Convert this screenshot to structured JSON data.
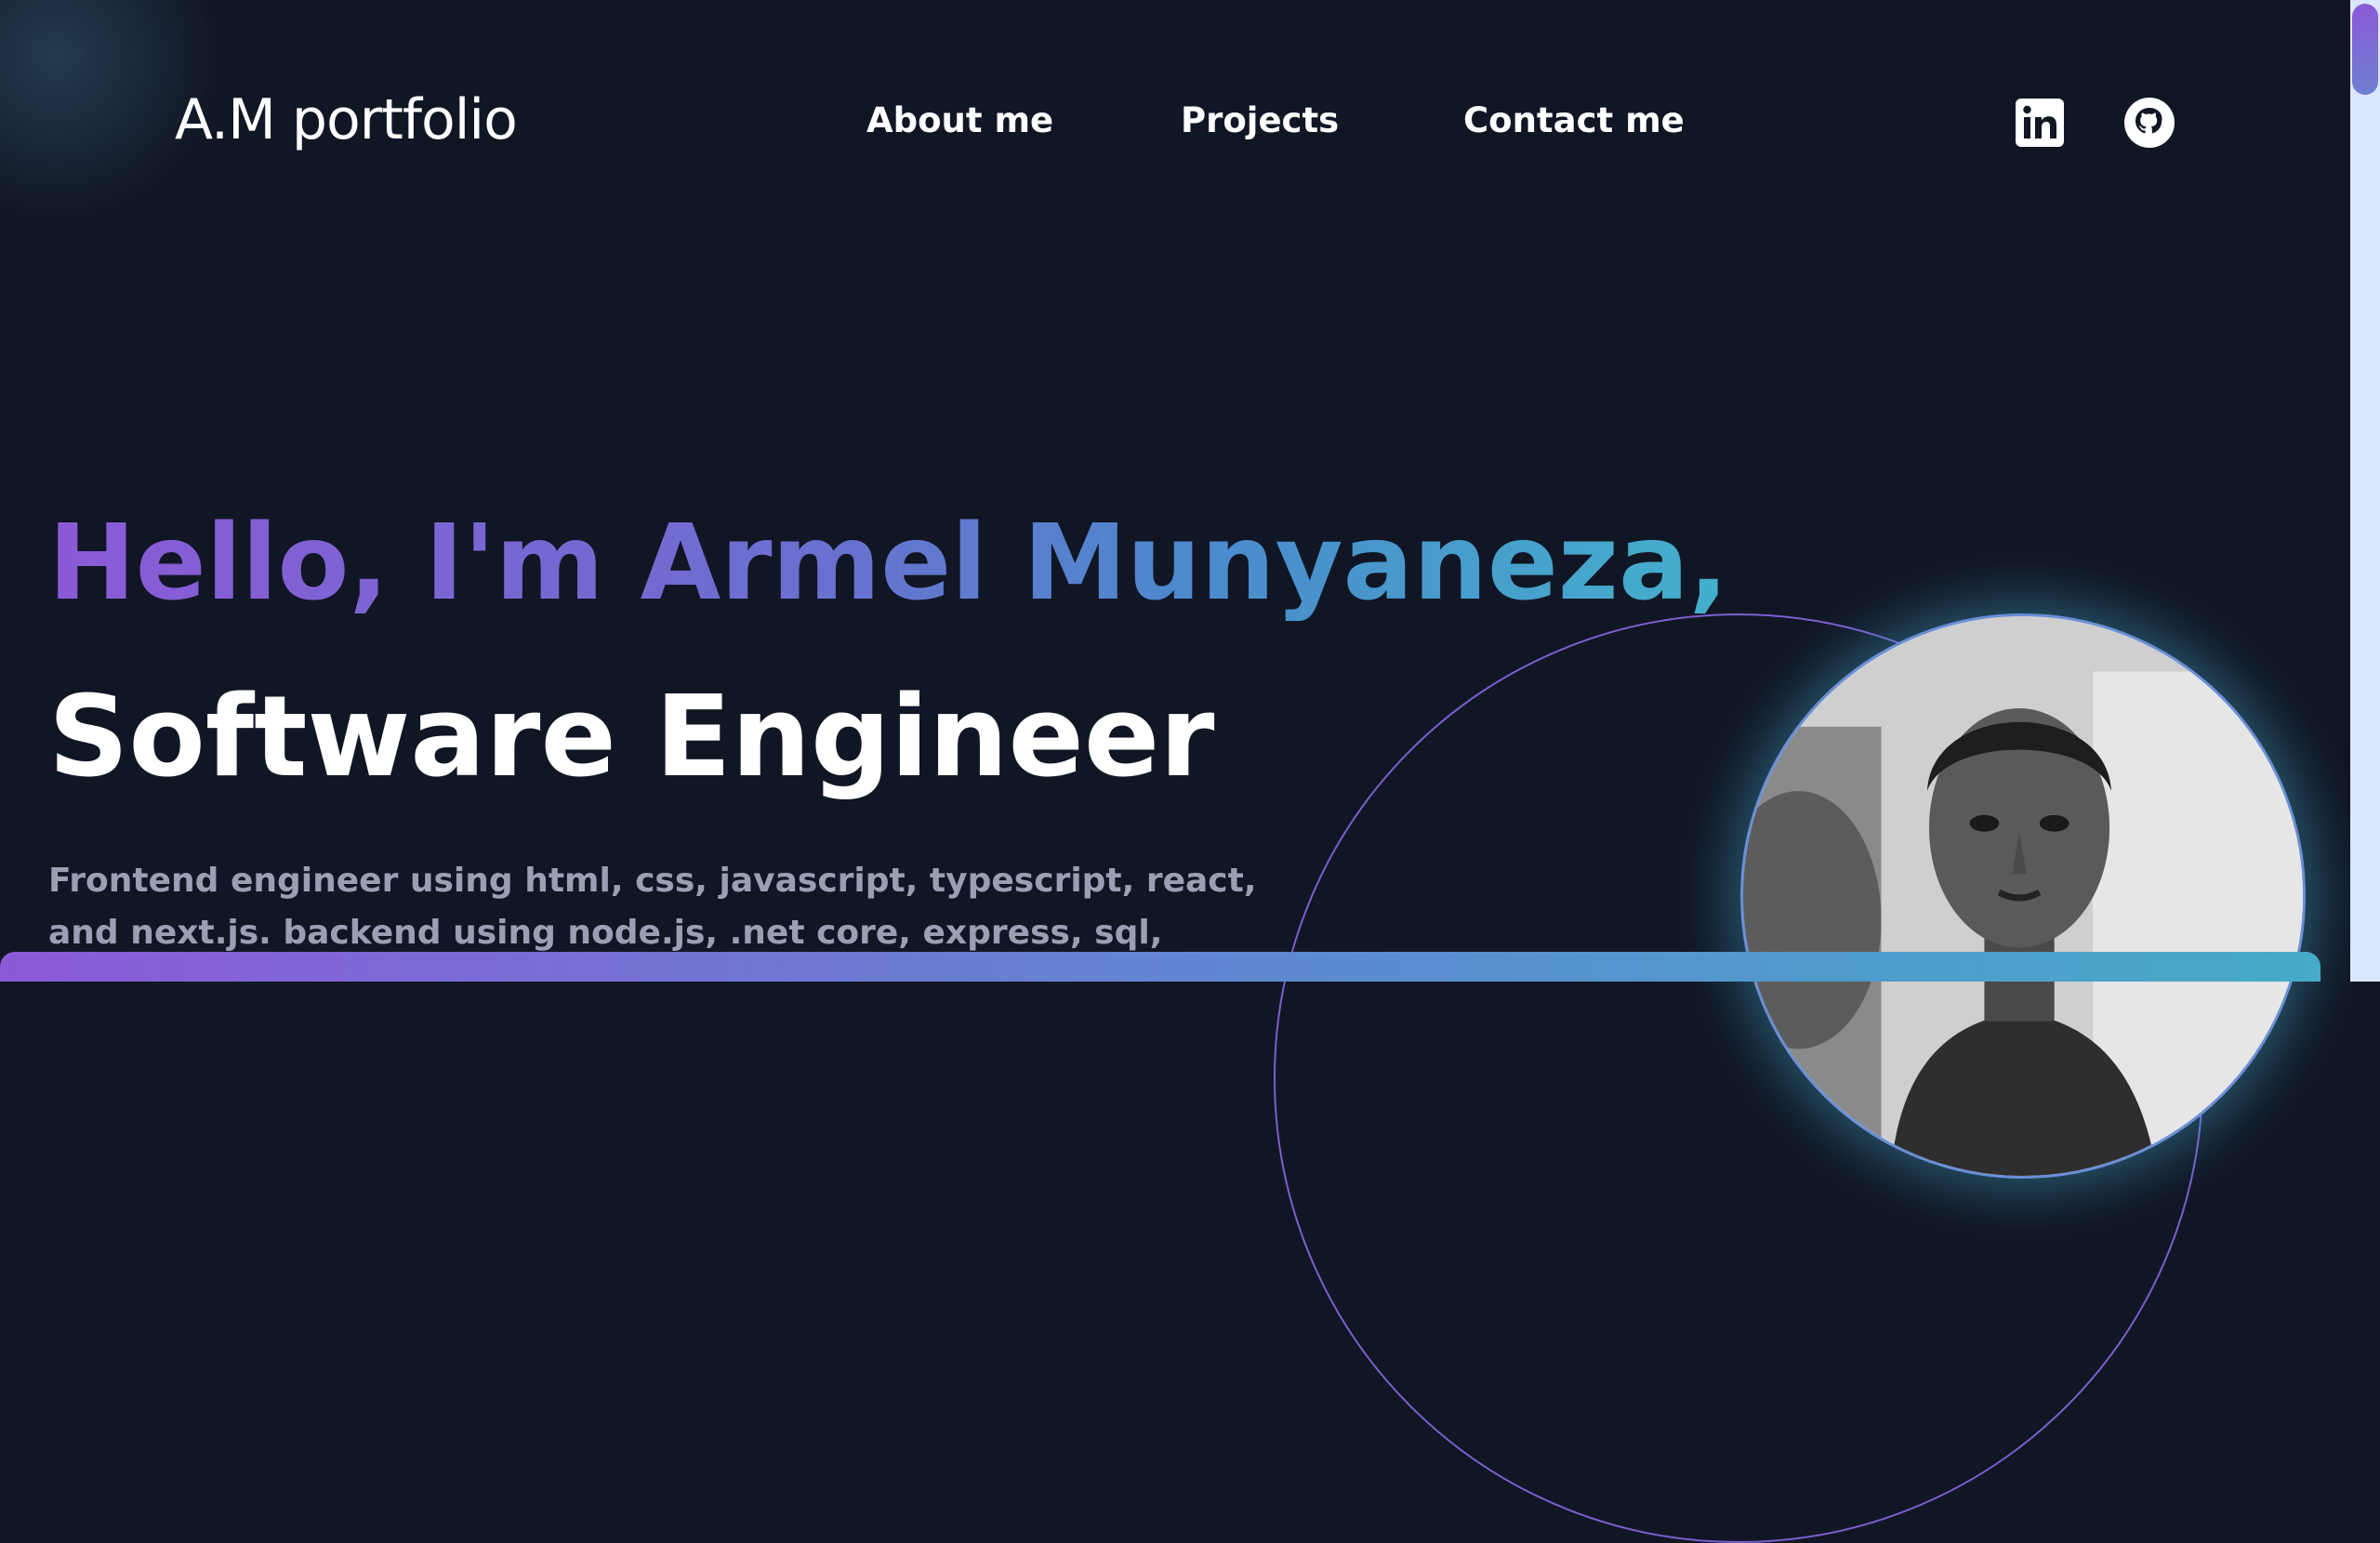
{
  "header": {
    "logo": "A.M portfolio",
    "nav": [
      {
        "label": "About me"
      },
      {
        "label": "Projects"
      },
      {
        "label": "Contact me"
      }
    ],
    "social_icons": [
      "linkedin-icon",
      "github-icon"
    ]
  },
  "hero": {
    "greeting": "Hello, I'm Armel Munyaneza,",
    "role": "Software Engineer",
    "description": "Frontend engineer using html, css, javascript, typescript, react, and next.js. backend using node.js, .net core, express, sql, postgres, and prisma. can a"
  },
  "colors": {
    "background": "#111625",
    "gradient_start": "#8b5ad6",
    "gradient_end": "#44b0cc",
    "description_text": "#9aa0b4"
  }
}
